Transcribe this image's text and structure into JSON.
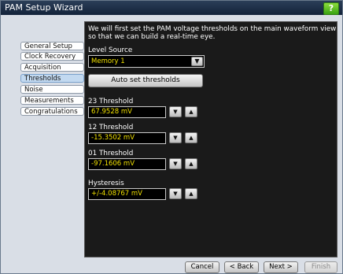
{
  "window": {
    "title": "PAM Setup Wizard",
    "help_label": "?"
  },
  "sidebar": {
    "items": [
      {
        "label": "General Setup"
      },
      {
        "label": "Clock Recovery"
      },
      {
        "label": "Acquisition"
      },
      {
        "label": "Thresholds"
      },
      {
        "label": "Noise"
      },
      {
        "label": "Measurements"
      },
      {
        "label": "Congratulations"
      }
    ],
    "active": "Thresholds"
  },
  "main": {
    "intro": "We will first set the PAM voltage thresholds on the main waveform view so that we can build a real-time eye.",
    "level_source": {
      "label": "Level Source",
      "value": "Memory 1"
    },
    "auto_set_label": "Auto set thresholds",
    "thresholds": [
      {
        "label": "23 Threshold",
        "value": "67.9528 mV"
      },
      {
        "label": "12 Threshold",
        "value": "-15.3502 mV"
      },
      {
        "label": "01 Threshold",
        "value": "-97.1606 mV"
      },
      {
        "label": "Hysteresis",
        "value": "+/-4.08767 mV"
      }
    ]
  },
  "footer": {
    "cancel": "Cancel",
    "back": "< Back",
    "next": "Next >",
    "finish": "Finish"
  },
  "icons": {
    "dropdown": "chevron-down-icon",
    "decrease": "chevron-down-icon",
    "increase": "chevron-up-icon"
  },
  "colors": {
    "titlebar": "#1d2e45",
    "panel_background": "#1a1a1a",
    "value_text": "#f0e000",
    "active_nav": "#c2d9f0",
    "help_button": "#5ec024"
  }
}
